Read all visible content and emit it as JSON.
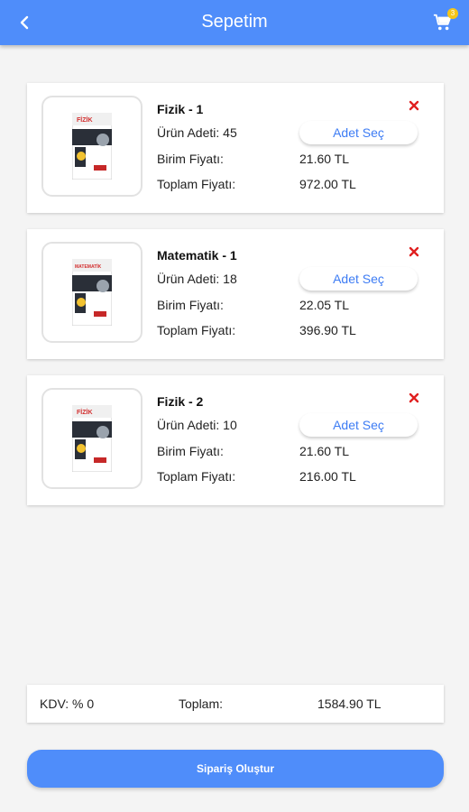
{
  "header": {
    "title": "Sepetim",
    "cart_count": "3",
    "color": "#4f8dfa"
  },
  "items": [
    {
      "name": "Fizik - 1",
      "quantity_text": "Ürün Adeti: 45",
      "select_label": "Adet Seç",
      "unit_label": "Birim Fiyatı:",
      "unit_price": "21.60 TL",
      "total_label": "Toplam Fiyatı:",
      "total_price": "972.00 TL"
    },
    {
      "name": "Matematik - 1",
      "quantity_text": "Ürün Adeti: 18",
      "select_label": "Adet Seç",
      "unit_label": "Birim Fiyatı:",
      "unit_price": "22.05 TL",
      "total_label": "Toplam Fiyatı:",
      "total_price": "396.90 TL"
    },
    {
      "name": "Fizik - 2",
      "quantity_text": "Ürün Adeti: 10",
      "select_label": "Adet Seç",
      "unit_label": "Birim Fiyatı:",
      "unit_price": "21.60 TL",
      "total_label": "Toplam Fiyatı:",
      "total_price": "216.00 TL"
    }
  ],
  "summary": {
    "kdv": "KDV: % 0",
    "total_label": "Toplam:",
    "total_value": "1584.90 TL"
  },
  "cta": {
    "label": "Sipariş Oluştur"
  },
  "icons": {
    "back": "chevron-left-icon",
    "cart": "cart-icon",
    "remove": "close-icon"
  }
}
